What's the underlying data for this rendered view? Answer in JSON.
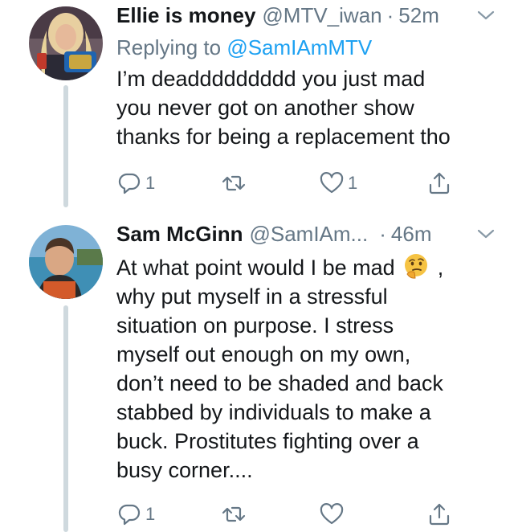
{
  "tweets": [
    {
      "display_name": "Ellie is money",
      "handle": "@MTV_iwan",
      "separator": "·",
      "time": "52m",
      "replying_prefix": "Replying to",
      "replying_to": "@SamIAmMTV",
      "text_lines": [
        "I’m deaddddddddd you just mad",
        "you never got on another show",
        "thanks for being a replacement tho"
      ],
      "reply_count": "1",
      "retweet_count": "",
      "like_count": "1"
    },
    {
      "display_name": "Sam McGinn",
      "handle": "@SamIAm...",
      "separator": "·",
      "time": "46m",
      "text_line_1_a": "At what point would I be mad",
      "text_line_1_b": ",",
      "text_lines": [
        "why put myself in a stressful",
        "situation on purpose. I stress",
        "myself out enough on my own,",
        "don’t need to be shaded and back",
        "stabbed by individuals to make a",
        "buck. Prostitutes fighting over a",
        "busy corner...."
      ],
      "emoji": "thinking-face",
      "reply_count": "1",
      "retweet_count": "",
      "like_count": ""
    }
  ],
  "colors": {
    "text": "#14171a",
    "secondary": "#657786",
    "link": "#1da1f2",
    "thread_line": "#cfd9de"
  }
}
